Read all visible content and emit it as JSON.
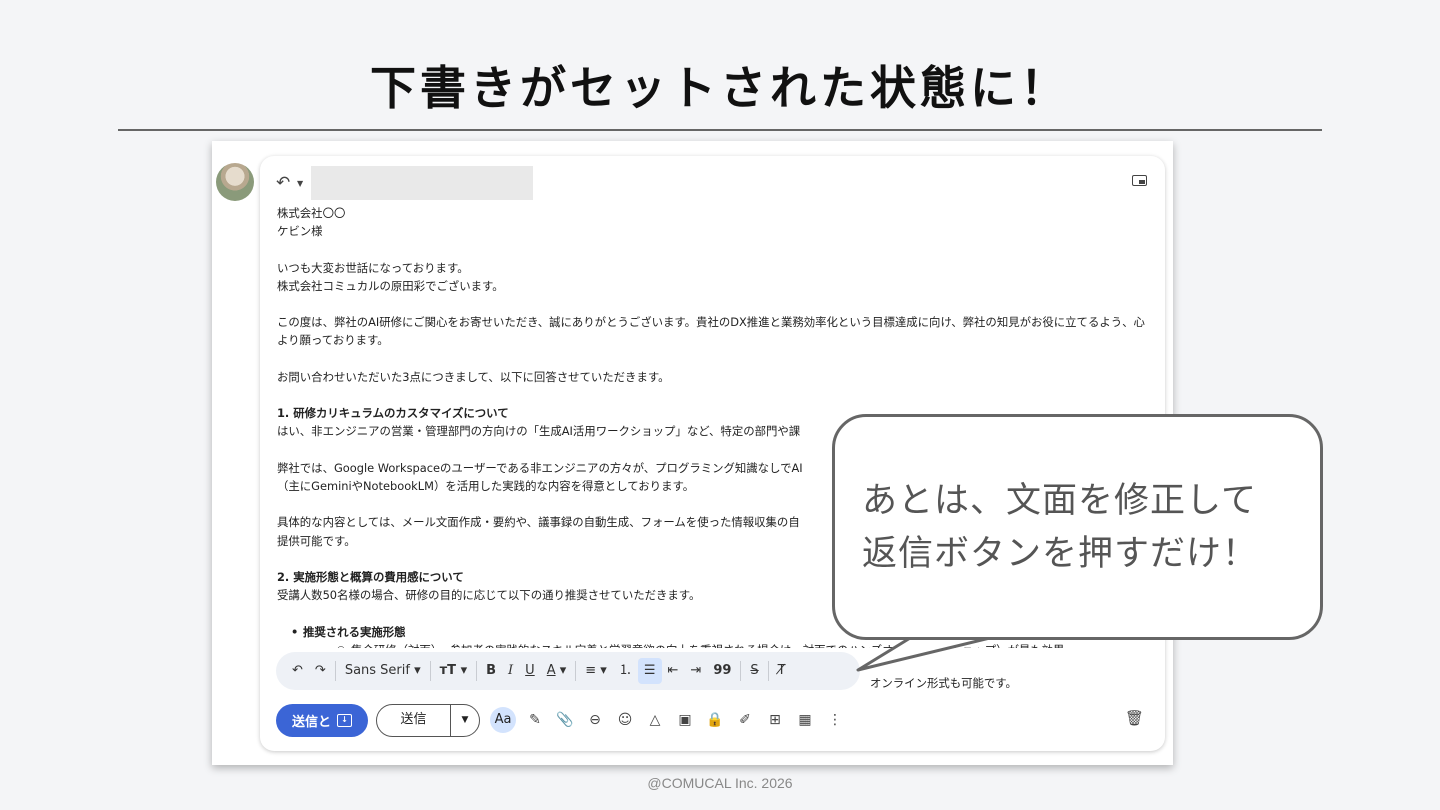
{
  "slide": {
    "title": "下書きがセットされた状態に！",
    "footer": "@COMUCAL Inc. 2026"
  },
  "email": {
    "lines": [
      {
        "text": "株式会社〇〇",
        "style": "normal"
      },
      {
        "text": "ケビン様",
        "style": "normal"
      },
      {
        "text": "",
        "style": "gap"
      },
      {
        "text": "いつも大変お世話になっております。",
        "style": "normal"
      },
      {
        "text": "株式会社コミュカルの原田彩でございます。",
        "style": "normal"
      },
      {
        "text": "",
        "style": "gap"
      },
      {
        "text": "この度は、弊社のAI研修にご関心をお寄せいただき、誠にありがとうございます。貴社のDX推進と業務効率化という目標達成に向け、弊社の知見がお役に立てるよう、心より願っております。",
        "style": "wrap"
      },
      {
        "text": "",
        "style": "gap"
      },
      {
        "text": "お問い合わせいただいた3点につきまして、以下に回答させていただきます。",
        "style": "normal"
      },
      {
        "text": "",
        "style": "gap"
      },
      {
        "text": "1. 研修カリキュラムのカスタマイズについて",
        "style": "bold"
      },
      {
        "text": "はい、非エンジニアの営業・管理部門の方向けの「生成AI活用ワークショップ」など、特定の部門や課",
        "style": "normal"
      },
      {
        "text": "",
        "style": "gap"
      },
      {
        "text": "弊社では、Google Workspaceのユーザーである非エンジニアの方々が、プログラミング知識なしでAI",
        "style": "normal"
      },
      {
        "text": "（主にGeminiやNotebookLM）を活用した実践的な内容を得意としております。",
        "style": "normal"
      },
      {
        "text": "",
        "style": "gap"
      },
      {
        "text": "具体的な内容としては、メール文面作成・要約や、議事録の自動生成、フォームを使った情報収集の自",
        "style": "normal"
      },
      {
        "text": "提供可能です。",
        "style": "normal"
      },
      {
        "text": "",
        "style": "gap"
      },
      {
        "text": "2. 実施形態と概算の費用感について",
        "style": "bold"
      },
      {
        "text": "受講人数50名様の場合、研修の目的に応じて以下の通り推奨させていただきます。",
        "style": "normal"
      },
      {
        "text": "",
        "style": "gap"
      },
      {
        "text": "推奨される実施形態",
        "style": "bullet1"
      },
      {
        "text": "集合研修（対面）: 参加者の実践的なスキル定着と学習意欲の向上を重視される場合は、対面でのハンズオン（ワークショップ）が最も効果",
        "style": "bullet2"
      }
    ],
    "after_toolbar_text": "オンライン形式も可能です。"
  },
  "toolbar": {
    "font": "Sans Serif",
    "undo": "↶",
    "redo": "↷",
    "size": "тT",
    "bold": "B",
    "italic": "I",
    "underline": "U",
    "color": "A"
  },
  "actions": {
    "send_dl_label": "送信と",
    "send_label": "送信",
    "aa_label": "Aa"
  },
  "callout": {
    "line1": "あとは、文面を修正して",
    "line2": "返信ボタンを押すだけ！"
  }
}
